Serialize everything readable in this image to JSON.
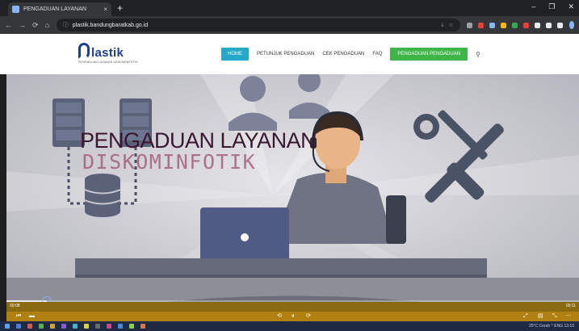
{
  "browser": {
    "tab_title": "PENGADUAN LAYANAN",
    "tab_close": "×",
    "new_tab": "+",
    "win_min": "–",
    "win_max": "❐",
    "win_close": "✕",
    "url": "plastik.bandungbaratkab.go.id",
    "nav_back": "←",
    "nav_forward": "→",
    "nav_reload": "⟳",
    "nav_home": "⌂",
    "lock_icon": "ⓘ",
    "omni_icons": [
      "⤓",
      "☆"
    ],
    "ext_colors": [
      "#9aa0a6",
      "#e94235",
      "#8ab4f8",
      "#fbbc04",
      "#34a853",
      "#e94235",
      "#e8eaed",
      "#e8eaed",
      "#e8eaed"
    ]
  },
  "site": {
    "logo_text": "lastik",
    "logo_tagline": "PENGADUAN LAYANAN DISKOMINFOTIK",
    "nav": {
      "home": "HOME",
      "items": [
        "PETUNJUK PENGADUAN",
        "CEK PENGADUAN",
        "FAQ"
      ],
      "cta": "PENGADUAN PENGADUAN",
      "search_icon": "⚲"
    },
    "colors": {
      "home_bg": "#26a8c9",
      "cta_bg": "#3fb54a",
      "brand": "#1b3f8b"
    }
  },
  "hero": {
    "title": "PENGADUAN LAYANAN",
    "subtitle": "DISKOMINFOTIK"
  },
  "video": {
    "time_elapsed": "00:08",
    "time_total": "00:11",
    "progress": 0.07,
    "controls_left": [
      "⏮",
      "▬"
    ],
    "controls_center": [
      "⟲",
      "⏸",
      "⟳"
    ],
    "controls_right": [
      "⤢",
      "▤",
      "⤡",
      "⋯"
    ]
  },
  "taskbar": {
    "icon_colors": [
      "#4a7fd4",
      "#d35a5a",
      "#5ab04a",
      "#d8a03a",
      "#8a5ad4",
      "#4ab0c8",
      "#d4d44a",
      "#6a6a6a",
      "#c84a8a",
      "#4a8ad4",
      "#8ad44a",
      "#d47a4a"
    ],
    "tray_text": "25°C Cerah  ^  ENG  13:10"
  }
}
